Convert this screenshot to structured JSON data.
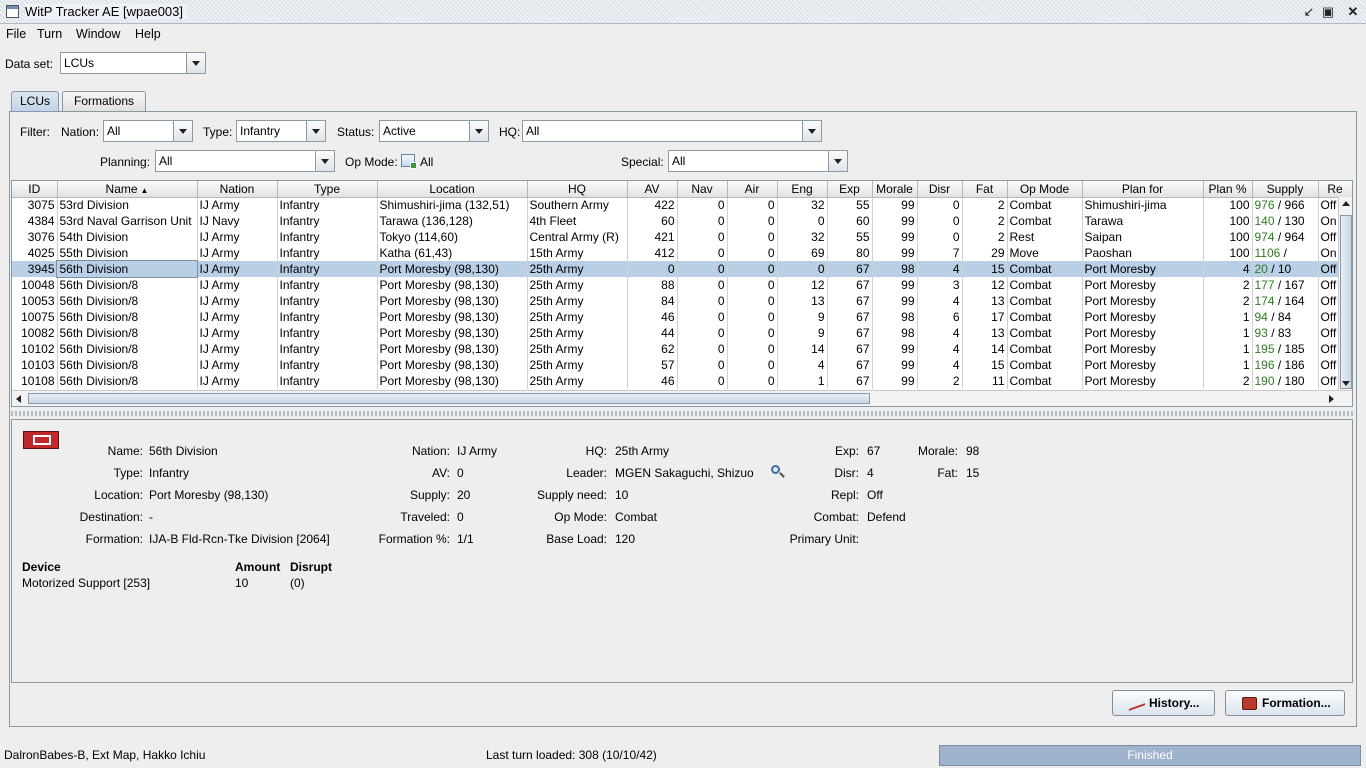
{
  "window": {
    "title": "WitP Tracker AE [wpae003]"
  },
  "menu": [
    "File",
    "Turn",
    "Window",
    "Help"
  ],
  "dataset": {
    "label": "Data set:",
    "value": "LCUs"
  },
  "tabs": [
    "LCUs",
    "Formations"
  ],
  "filter": {
    "filter_label": "Filter:",
    "nation_label": "Nation:",
    "nation": "All",
    "type_label": "Type:",
    "type": "Infantry",
    "status_label": "Status:",
    "status": "Active",
    "hq_label": "HQ:",
    "hq": "All",
    "planning_label": "Planning:",
    "planning": "All",
    "opmode_label": "Op Mode:",
    "opmode": "All",
    "special_label": "Special:",
    "special": "All"
  },
  "table": {
    "columns": [
      "ID",
      "Name",
      "Nation",
      "Type",
      "Location",
      "HQ",
      "AV",
      "Nav",
      "Air",
      "Eng",
      "Exp",
      "Morale",
      "Disr",
      "Fat",
      "Op Mode",
      "Plan for",
      "Plan %",
      "Supply",
      "Re"
    ],
    "sort_indicator": "▲",
    "rows": [
      [
        "3075",
        "53rd Division",
        "IJ Army",
        "Infantry",
        "Shimushiri-jima (132,51)",
        "Southern Army",
        "422",
        "0",
        "0",
        "32",
        "55",
        "99",
        "0",
        "2",
        "Combat",
        "Shimushiri-jima",
        "100",
        "976",
        " / 966",
        "Off"
      ],
      [
        "4384",
        "53rd Naval Garrison Unit",
        "IJ Navy",
        "Infantry",
        "Tarawa (136,128)",
        "4th Fleet",
        "60",
        "0",
        "0",
        "0",
        "60",
        "99",
        "0",
        "2",
        "Combat",
        "Tarawa",
        "100",
        "140",
        " / 130",
        "On"
      ],
      [
        "3076",
        "54th Division",
        "IJ Army",
        "Infantry",
        "Tokyo (114,60)",
        "Central Army (R)",
        "421",
        "0",
        "0",
        "32",
        "55",
        "99",
        "0",
        "2",
        "Rest",
        "Saipan",
        "100",
        "974",
        " / 964",
        "Off"
      ],
      [
        "4025",
        "55th Division",
        "IJ Army",
        "Infantry",
        "Katha (61,43)",
        "15th Army",
        "412",
        "0",
        "0",
        "69",
        "80",
        "99",
        "7",
        "29",
        "Move",
        "Paoshan",
        "100",
        "1106",
        " / ",
        "On"
      ],
      [
        "3945",
        "56th Division",
        "IJ Army",
        "Infantry",
        "Port Moresby (98,130)",
        "25th Army",
        "0",
        "0",
        "0",
        "0",
        "67",
        "98",
        "4",
        "15",
        "Combat",
        "Port Moresby",
        "4",
        "20",
        " / 10",
        "Off"
      ],
      [
        "10048",
        "56th Division/8",
        "IJ Army",
        "Infantry",
        "Port Moresby (98,130)",
        "25th Army",
        "88",
        "0",
        "0",
        "12",
        "67",
        "99",
        "3",
        "12",
        "Combat",
        "Port Moresby",
        "2",
        "177",
        " / 167",
        "Off"
      ],
      [
        "10053",
        "56th Division/8",
        "IJ Army",
        "Infantry",
        "Port Moresby (98,130)",
        "25th Army",
        "84",
        "0",
        "0",
        "13",
        "67",
        "99",
        "4",
        "13",
        "Combat",
        "Port Moresby",
        "2",
        "174",
        " / 164",
        "Off"
      ],
      [
        "10075",
        "56th Division/8",
        "IJ Army",
        "Infantry",
        "Port Moresby (98,130)",
        "25th Army",
        "46",
        "0",
        "0",
        "9",
        "67",
        "98",
        "6",
        "17",
        "Combat",
        "Port Moresby",
        "1",
        "94",
        " / 84",
        "Off"
      ],
      [
        "10082",
        "56th Division/8",
        "IJ Army",
        "Infantry",
        "Port Moresby (98,130)",
        "25th Army",
        "44",
        "0",
        "0",
        "9",
        "67",
        "98",
        "4",
        "13",
        "Combat",
        "Port Moresby",
        "1",
        "93",
        " / 83",
        "Off"
      ],
      [
        "10102",
        "56th Division/8",
        "IJ Army",
        "Infantry",
        "Port Moresby (98,130)",
        "25th Army",
        "62",
        "0",
        "0",
        "14",
        "67",
        "99",
        "4",
        "14",
        "Combat",
        "Port Moresby",
        "1",
        "195",
        " / 185",
        "Off"
      ],
      [
        "10103",
        "56th Division/8",
        "IJ Army",
        "Infantry",
        "Port Moresby (98,130)",
        "25th Army",
        "57",
        "0",
        "0",
        "4",
        "67",
        "99",
        "4",
        "15",
        "Combat",
        "Port Moresby",
        "1",
        "196",
        " / 186",
        "Off"
      ],
      [
        "10108",
        "56th Division/8",
        "IJ Army",
        "Infantry",
        "Port Moresby (98,130)",
        "25th Army",
        "46",
        "0",
        "0",
        "1",
        "67",
        "99",
        "2",
        "11",
        "Combat",
        "Port Moresby",
        "2",
        "190",
        " / 180",
        "Off"
      ]
    ],
    "selected_row": 4
  },
  "detail": {
    "name_label": "Name:",
    "name": "56th Division",
    "type_label": "Type:",
    "type": "Infantry",
    "location_label": "Location:",
    "location": "Port Moresby (98,130)",
    "destination_label": "Destination:",
    "destination": "-",
    "formation_label": "Formation:",
    "formation": "IJA-B Fld-Rcn-Tke Division [2064]",
    "nation_label": "Nation:",
    "nation": "IJ Army",
    "av_label": "AV:",
    "av": "0",
    "supply_label": "Supply:",
    "supply": "20",
    "traveled_label": "Traveled:",
    "traveled": "0",
    "formation_pct_label": "Formation %:",
    "formation_pct": "1/1",
    "hq_label": "HQ:",
    "hq": "25th Army",
    "leader_label": "Leader:",
    "leader": "MGEN Sakaguchi, Shizuo",
    "supply_need_label": "Supply need:",
    "supply_need": "10",
    "opmode_label": "Op Mode:",
    "opmode": "Combat",
    "baseload_label": "Base Load:",
    "baseload": "120",
    "exp_label": "Exp:",
    "exp": "67",
    "disr_label": "Disr:",
    "disr": "4",
    "repl_label": "Repl:",
    "repl": "Off",
    "combat_label": "Combat:",
    "combat": "Defend",
    "primary_label": "Primary Unit:",
    "morale_label": "Morale:",
    "morale": "98",
    "fat_label": "Fat:",
    "fat": "15",
    "device_header": "Device",
    "amount_header": "Amount",
    "disrupt_header": "Disrupt",
    "devices": [
      {
        "device": "Motorized Support [253]",
        "amount": "10",
        "disrupt": "(0)"
      }
    ]
  },
  "buttons": {
    "history": "History...",
    "formation": "Formation..."
  },
  "status": {
    "left": "DalronBabes-B, Ext Map, Hakko Ichiu",
    "center": "Last turn loaded: 308 (10/10/42)",
    "progress": "Finished"
  },
  "colors": {
    "selected_row": "#b8cfe5",
    "supply_green": "#2e7d20",
    "progress": "#9fb3cf",
    "flag": "#c0282a"
  }
}
